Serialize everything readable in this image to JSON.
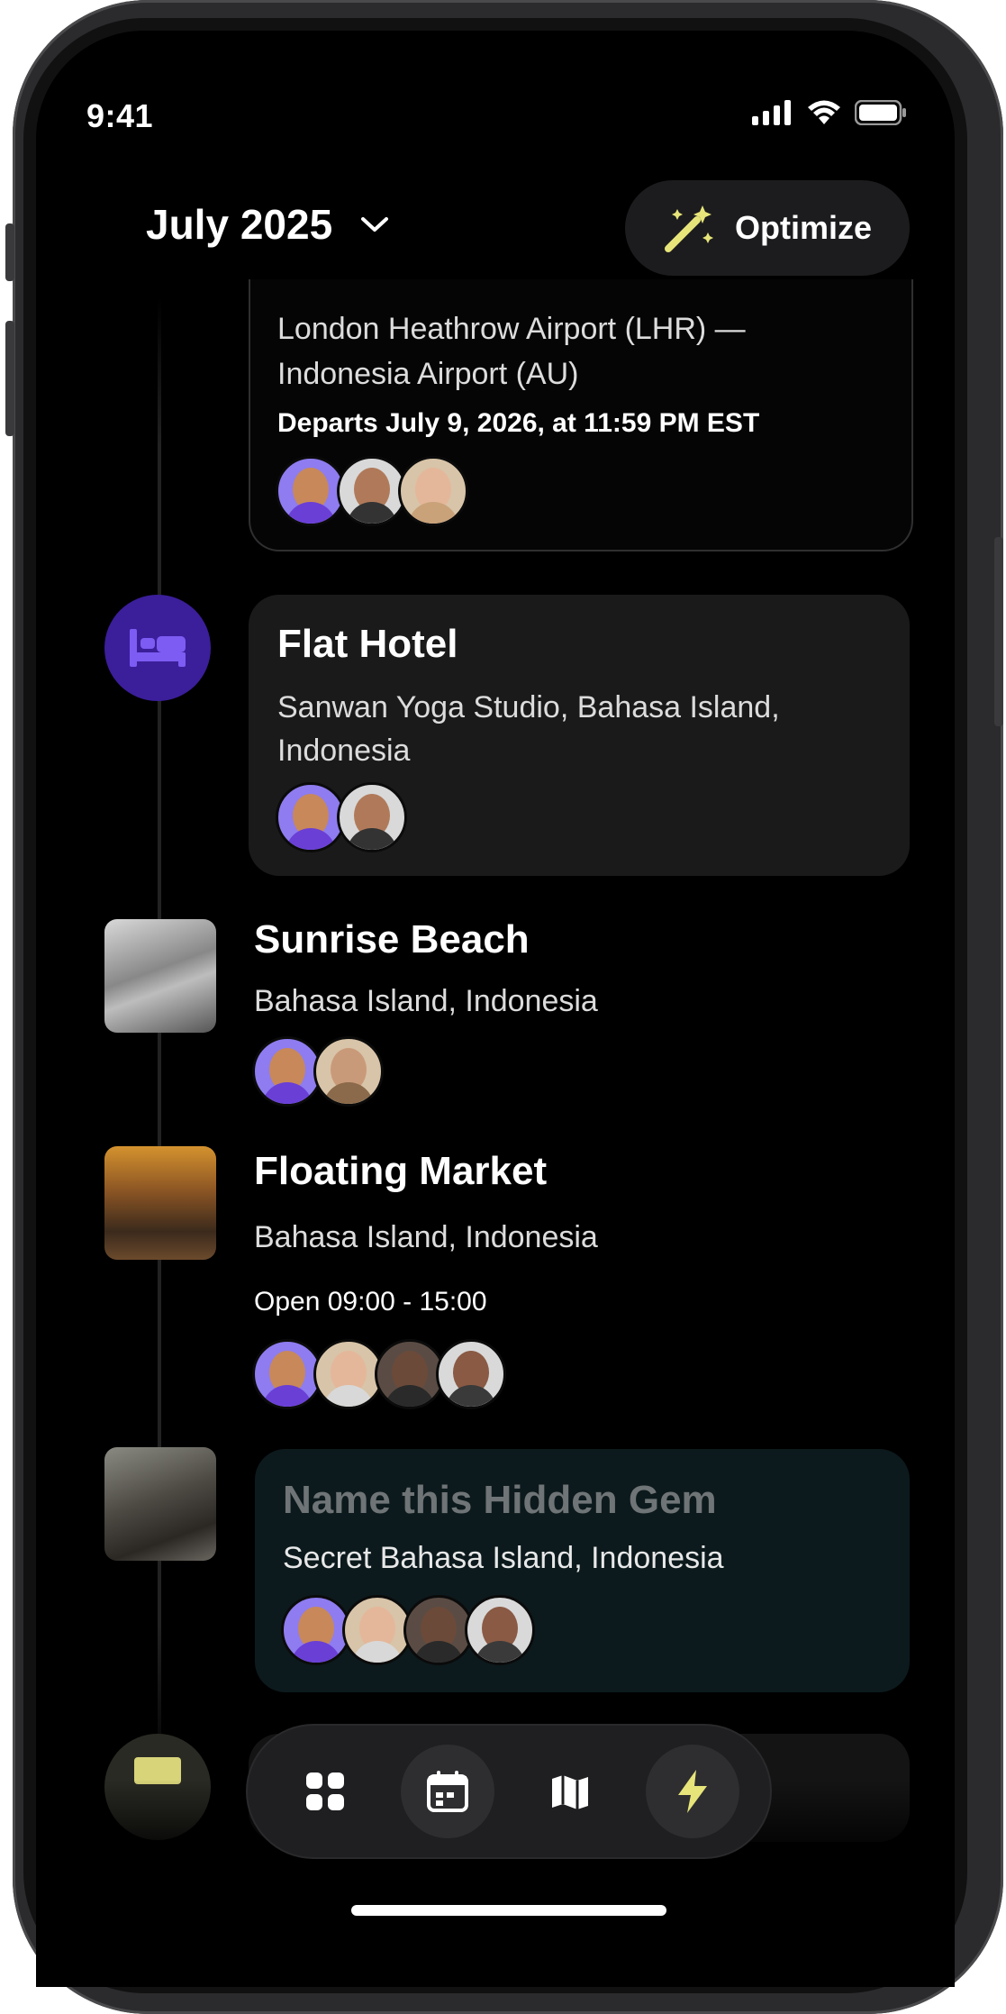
{
  "status": {
    "time": "9:41"
  },
  "header": {
    "month": "July 2025",
    "optimize_label": "Optimize"
  },
  "flight": {
    "route_line1": "London Heathrow Airport (LHR) —",
    "route_line2": "Indonesia Airport (AU)",
    "departs": "Departs July 9, 2026, at 11:59 PM EST"
  },
  "hotel": {
    "title": "Flat Hotel",
    "address_line1": "Sanwan Yoga Studio, Bahasa Island,",
    "address_line2": "Indonesia"
  },
  "beach": {
    "title": "Sunrise Beach",
    "location": "Bahasa Island, Indonesia"
  },
  "market": {
    "title": "Floating Market",
    "location": "Bahasa Island, Indonesia",
    "hours": "Open 09:00 - 15:00"
  },
  "gem": {
    "title": "Name this Hidden Gem",
    "location": "Secret Bahasa Island, Indonesia"
  },
  "bottom_nav": [
    "grid-icon",
    "calendar-icon",
    "map-icon",
    "lightning-icon"
  ],
  "colors": {
    "accent_purple": "#3b1e9a",
    "lightning": "#e7e57a",
    "gem_card": "#0c1a1d"
  }
}
